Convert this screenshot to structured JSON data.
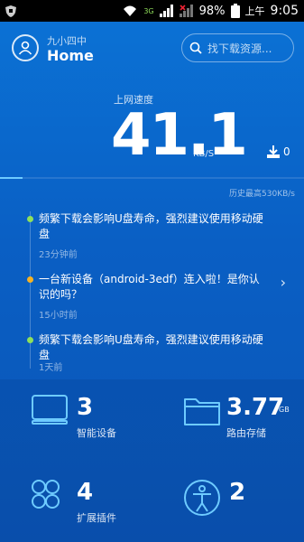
{
  "status_bar": {
    "network_labels": [
      "3G"
    ],
    "battery_percent": "98%",
    "time_prefix": "上午",
    "time": "9:05"
  },
  "header": {
    "network_name": "九小四中",
    "title": "Home",
    "search_placeholder": "找下载资源..."
  },
  "speed": {
    "label": "上网速度",
    "value": "41.1",
    "unit": "KB/S",
    "download_count": "0",
    "history_max": "历史最高530KB/s"
  },
  "timeline": {
    "items": [
      {
        "text": "频繁下载会影响U盘寿命，强烈建议使用移动硬盘",
        "time": "23分钟前",
        "dot_color": "#8fe05a",
        "has_chevron": false
      },
      {
        "text": "一台新设备（android-3edf）连入啦！是你认识的吗？",
        "time": "15小时前",
        "dot_color": "#f5b323",
        "has_chevron": true
      },
      {
        "text": "频繁下载会影响U盘寿命，强烈建议使用移动硬盘",
        "time": "1天前",
        "dot_color": "#8fe05a",
        "has_chevron": false
      }
    ]
  },
  "tiles": [
    {
      "icon": "monitor-icon",
      "count": "3",
      "unit": "",
      "label": "智能设备"
    },
    {
      "icon": "folder-icon",
      "count": "3.77",
      "unit": "GB",
      "label": "路由存储"
    },
    {
      "icon": "grid-circles-icon",
      "count": "4",
      "unit": "",
      "label": "扩展插件"
    },
    {
      "icon": "person-circle-icon",
      "count": "2",
      "unit": "",
      "label": ""
    }
  ],
  "colors": {
    "accent": "#6ecbff",
    "background_top": "#0b73d6",
    "background_bottom": "#0b55b6"
  }
}
